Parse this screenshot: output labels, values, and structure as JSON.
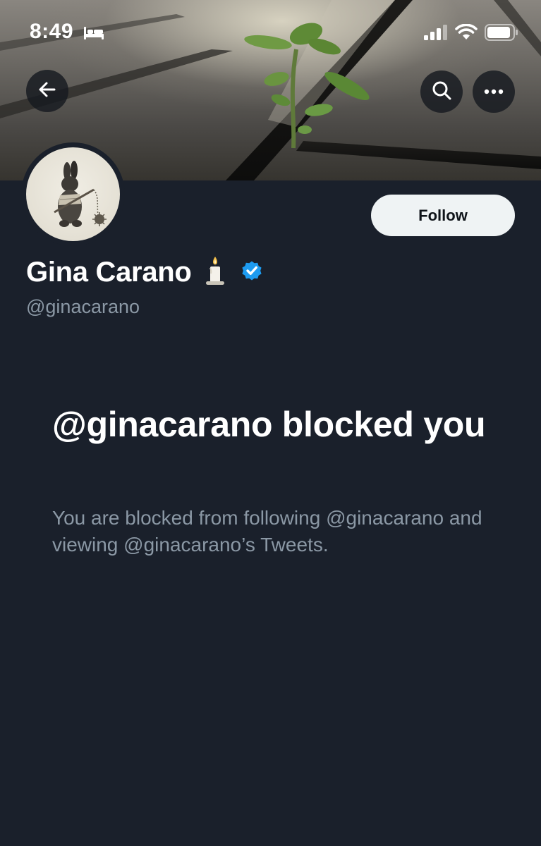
{
  "status_bar": {
    "time": "8:49",
    "bed_icon": "bed-icon",
    "signal_icon": "cellular-signal-icon",
    "wifi_icon": "wifi-icon",
    "battery_icon": "battery-icon"
  },
  "header": {
    "back_icon": "arrow-left-icon",
    "search_icon": "search-icon",
    "more_icon": "more-horizontal-icon"
  },
  "profile": {
    "display_name": "Gina Carano",
    "name_emoji_icon": "candle-icon",
    "verified_icon": "verified-badge-icon",
    "handle": "@ginacarano",
    "follow_label": "Follow"
  },
  "blocked": {
    "title": "@ginacarano blocked you",
    "description": "You are blocked from following @ginacarano and viewing @ginacarano’s Tweets."
  },
  "colors": {
    "background": "#1a202b",
    "secondary_text": "#8b98a5",
    "verified_blue": "#1d9bf0",
    "follow_bg": "#eff3f4"
  }
}
